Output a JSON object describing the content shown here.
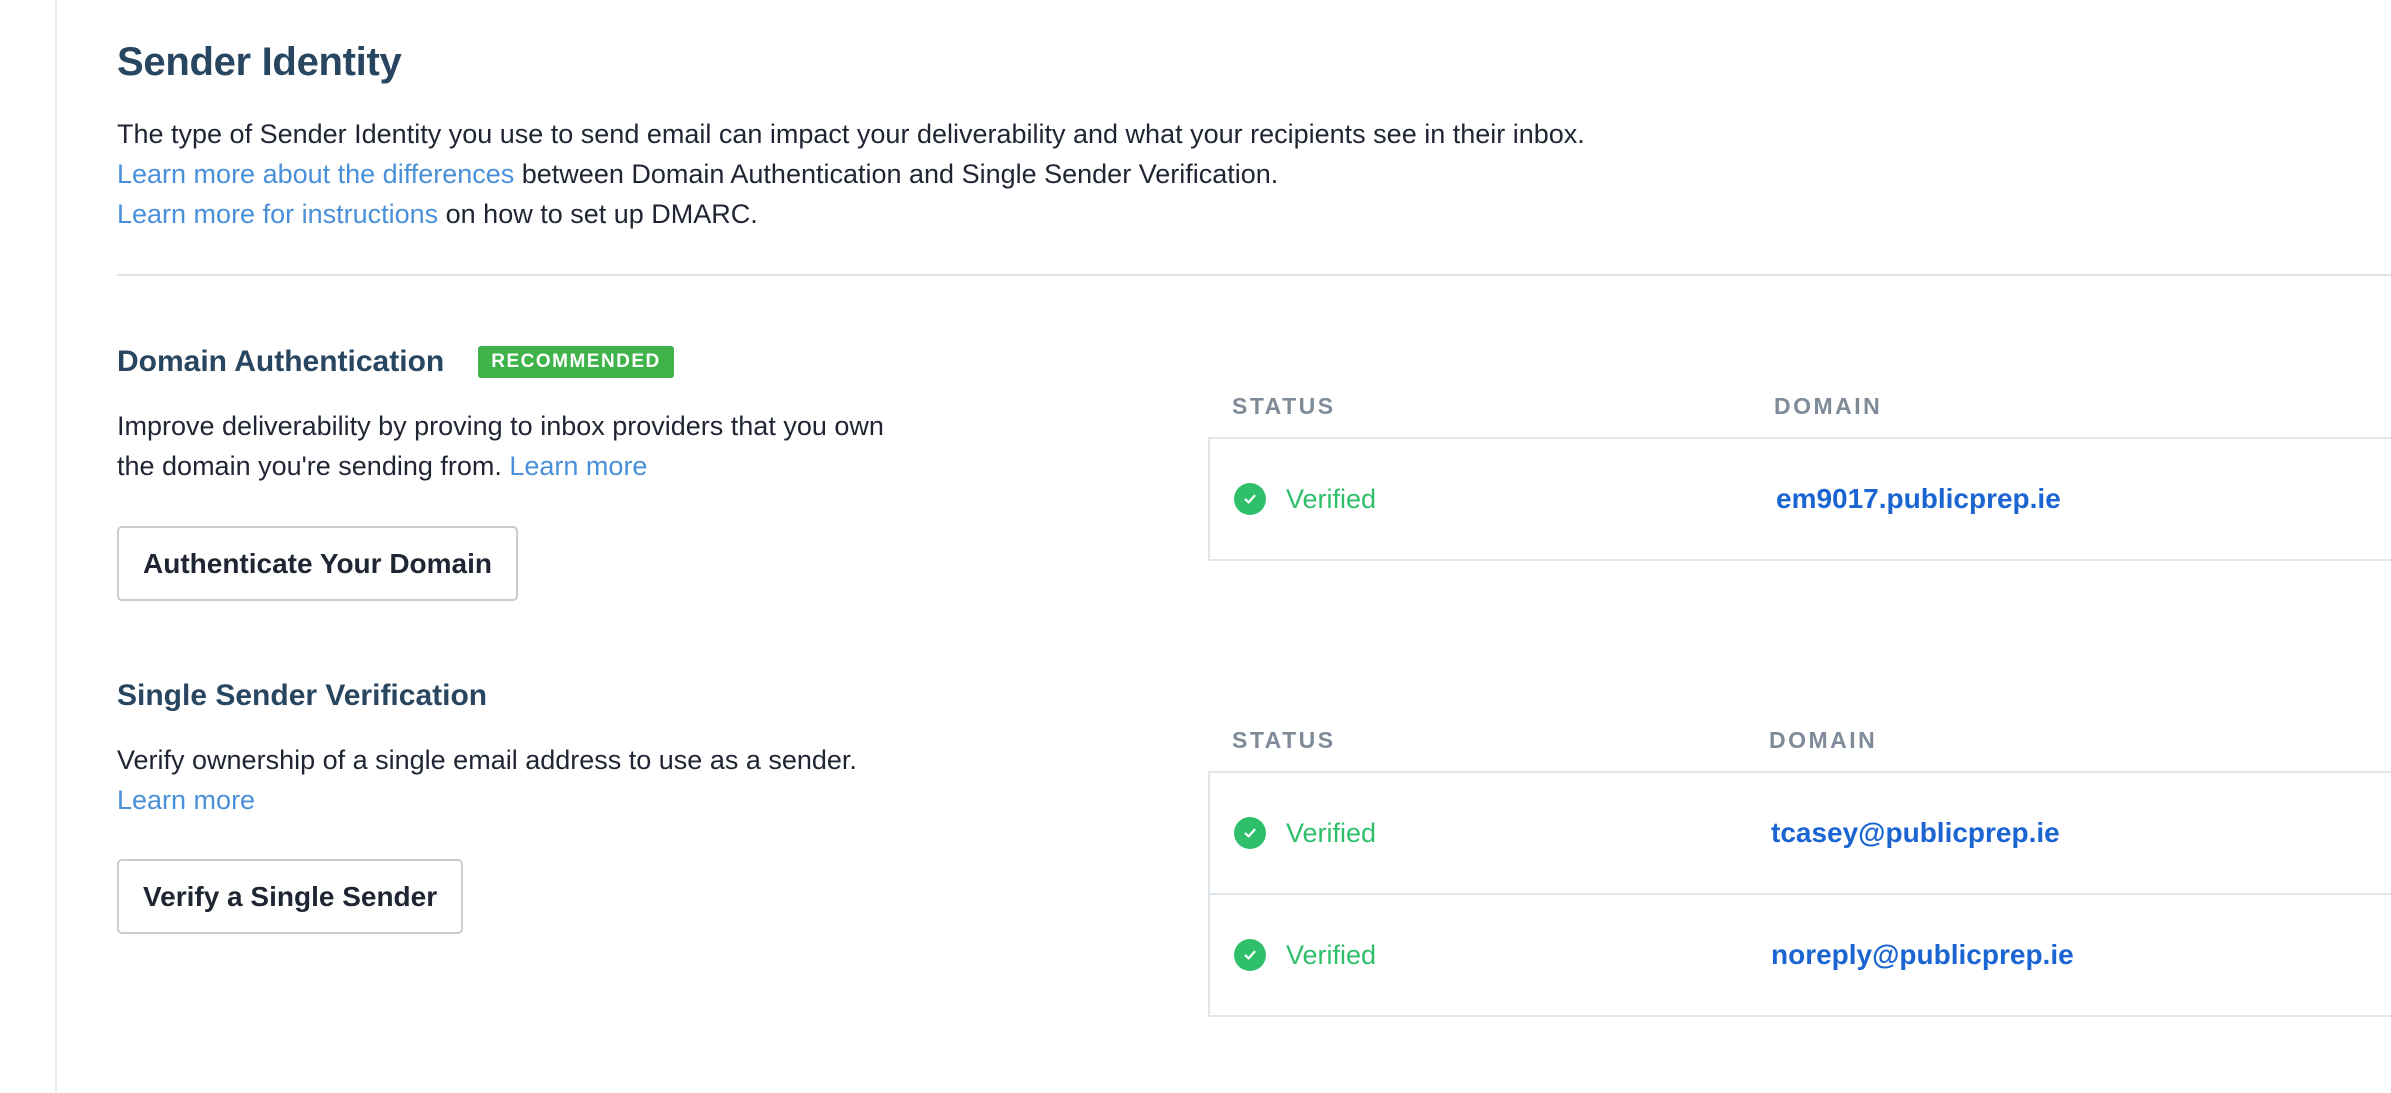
{
  "page": {
    "title": "Sender Identity",
    "intro_line": "The type of Sender Identity you use to send email can impact your deliverability and what your recipients see in their inbox.",
    "differences_link": "Learn more about the differences",
    "differences_rest": " between Domain Authentication and Single Sender Verification.",
    "dmarc_link": "Learn more for instructions",
    "dmarc_rest": " on how to set up DMARC."
  },
  "domain_auth": {
    "heading": "Domain Authentication",
    "badge": "RECOMMENDED",
    "desc_line1": "Improve deliverability by proving to inbox providers that you own",
    "desc_line2": "the domain you're sending from. ",
    "learn_more": "Learn more",
    "button": "Authenticate Your Domain",
    "table": {
      "status_header": "STATUS",
      "domain_header": "DOMAIN",
      "rows": [
        {
          "status": "Verified",
          "domain": "em9017.publicprep.ie",
          "status_icon": "check-circle-icon"
        }
      ]
    }
  },
  "single_sender": {
    "heading": "Single Sender Verification",
    "desc_line1": "Verify ownership of a single email address to use as a sender.",
    "learn_more": "Learn more",
    "button": "Verify a Single Sender",
    "table": {
      "status_header": "STATUS",
      "domain_header": "DOMAIN",
      "rows": [
        {
          "status": "Verified",
          "domain": "tcasey@publicprep.ie",
          "status_icon": "check-circle-icon"
        },
        {
          "status": "Verified",
          "domain": "noreply@publicprep.ie",
          "status_icon": "check-circle-icon"
        }
      ]
    }
  },
  "colors": {
    "heading": "#294661",
    "link": "#4a90d9",
    "badge": "#3fb24a",
    "verified": "#2fbf6a",
    "domain_link": "#1a65d1"
  }
}
